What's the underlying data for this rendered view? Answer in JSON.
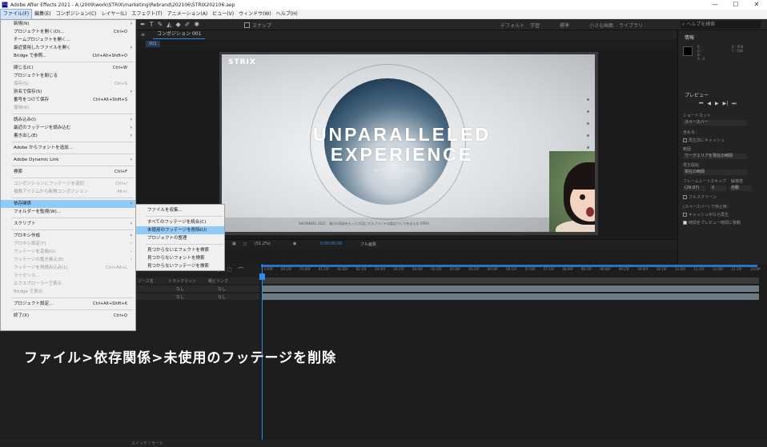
{
  "window": {
    "title": "Adobe After Effects 2021 - A:\\2009\\work\\STRIX\\marketing\\Rebrand\\202106\\STRIX202106.aep",
    "icon_text": "Ae",
    "controls": [
      "—",
      "☐",
      "✕"
    ]
  },
  "menubar": {
    "items": [
      "ファイル(F)",
      "編集(E)",
      "コンポジション(C)",
      "レイヤー(L)",
      "エフェクト(T)",
      "アニメーション(A)",
      "ビュー(V)",
      "ウィンドウ(W)",
      "ヘルプ(H)"
    ],
    "active_index": 0
  },
  "toolbar": {
    "snap_label": "スナップ",
    "workspaces": [
      "デフォルト",
      "学習",
      "標準",
      "小さな画面",
      "ライブラリ"
    ],
    "search_placeholder": "ヘルプを検索"
  },
  "composition": {
    "tab_label": "コンポジション 001",
    "comp_chip": "001",
    "banner": {
      "logo": "STRIX",
      "title_line1": "UNPARALLELED",
      "title_line2": "EXPERIENCE",
      "subtitle": "わくわく、を、えらぼう。",
      "footer": "SHOWREEL 2021　毎日の家族をもっと大切にするブランドの製品づくりを支える STRIX"
    },
    "viewer_controls": {
      "zoom": "(51.2%)",
      "timecode": "0:00:00:00",
      "resolution": "フル画質"
    }
  },
  "right_panel": {
    "info_title": "情報",
    "info_values_left": [
      "R :",
      "G :",
      "B :",
      "A : 0"
    ],
    "info_values_right": [
      "X : 958",
      "Y : 548"
    ],
    "preview_title": "プレビュー",
    "preview_buttons": [
      "⏮",
      "◀",
      "▶",
      "▶|",
      "⏭"
    ],
    "shortcut_label": "ショートカット",
    "shortcut_value": "スペースバー",
    "include_label": "含める：",
    "cache_label": "再生前にキャッシュ",
    "range_label": "範囲",
    "range_value": "ワークエリアを現在の時間",
    "play_from_label": "再生開始",
    "play_from_value": "現在の時間",
    "frame_rate_label": "フレームレート",
    "skip_label": "スキップ",
    "resolution_label": "解像度",
    "frame_rate_value": "(29.97)",
    "skip_value": "0",
    "resolution_value": "自動",
    "fullscreen_label": "フルスクリーン",
    "stop_label": "(スペースバー) で停止時：",
    "option1": "キャッシュ中なら再生",
    "option2": "時間をプレビュー時間に移動"
  },
  "timeline": {
    "columns": [
      "ソース名",
      "トラックマット",
      "親とリンク"
    ],
    "rows": [
      {
        "label": "なし",
        "parent": "なし"
      },
      {
        "label": "なし",
        "parent": "なし"
      }
    ],
    "ruler_ticks": [
      "0:00f",
      "00:15f",
      "01:00f",
      "01:15f",
      "02:00f",
      "02:15f",
      "03:00f",
      "03:15f",
      "04:00f",
      "04:15f",
      "05:00f",
      "05:15f",
      "06:00f",
      "06:15f",
      "07:00f",
      "07:15f",
      "08:00f",
      "08:15f",
      "09:00f",
      "09:15f",
      "10:00f",
      "10:15f",
      "11:00f",
      "11:15f",
      "12:00f",
      "12:15f",
      "13:00f"
    ],
    "status_toggle": "スイッチ / モード"
  },
  "file_menu": {
    "groups": [
      [
        {
          "label": "新規(N)",
          "arrow": true
        },
        {
          "label": "プロジェクトを開く(O)...",
          "shortcut": "Ctrl+O"
        },
        {
          "label": "チームプロジェクトを開く..."
        },
        {
          "label": "最近使用したファイルを開く",
          "arrow": true
        },
        {
          "label": "Bridge で参照...",
          "shortcut": "Ctrl+Alt+Shift+O"
        }
      ],
      [
        {
          "label": "閉じる(C)",
          "shortcut": "Ctrl+W"
        },
        {
          "label": "プロジェクトを閉じる"
        },
        {
          "label": "保存(S)",
          "shortcut": "Ctrl+S",
          "disabled": true
        },
        {
          "label": "別名で保存(S)",
          "arrow": true
        },
        {
          "label": "番号をつけて保存",
          "shortcut": "Ctrl+Alt+Shift+S"
        },
        {
          "label": "復帰(R)",
          "disabled": true
        }
      ],
      [
        {
          "label": "読み込み(I)",
          "arrow": true
        },
        {
          "label": "最近のフッテージを読み込む",
          "arrow": true
        },
        {
          "label": "書き出し(E)",
          "arrow": true
        }
      ],
      [
        {
          "label": "Adobe からフォントを追加..."
        }
      ],
      [
        {
          "label": "Adobe Dynamic Link",
          "arrow": true
        }
      ],
      [
        {
          "label": "検索",
          "shortcut": "Ctrl+F"
        }
      ],
      [
        {
          "label": "コンポジションにフッテージを追加",
          "shortcut": "Ctrl+/",
          "disabled": true
        },
        {
          "label": "複数アイテムから新規コンポジション",
          "shortcut": "Alt+\\",
          "disabled": true
        }
      ],
      [
        {
          "label": "依存関係",
          "arrow": true,
          "highlight": true
        },
        {
          "label": "フォルダーを監視(W)..."
        }
      ],
      [
        {
          "label": "スクリプト",
          "arrow": true
        }
      ],
      [
        {
          "label": "プロキシ作成",
          "arrow": true
        },
        {
          "label": "プロキシ設定(Y)",
          "arrow": true,
          "disabled": true
        },
        {
          "label": "フッテージを変換(G)",
          "arrow": true,
          "disabled": true
        },
        {
          "label": "フッテージの置き換え(E)",
          "arrow": true,
          "disabled": true
        },
        {
          "label": "フッテージを再読み込み(L)",
          "shortcut": "Ctrl+Alt+L",
          "disabled": true
        },
        {
          "label": "ライセンス...",
          "disabled": true
        },
        {
          "label": "エクスプローラーで表示",
          "disabled": true
        },
        {
          "label": "Bridge で表示",
          "disabled": true
        }
      ],
      [
        {
          "label": "プロジェクト設定...",
          "shortcut": "Ctrl+Alt+Shift+K"
        }
      ],
      [
        {
          "label": "終了(X)",
          "shortcut": "Ctrl+Q"
        }
      ]
    ]
  },
  "submenu": {
    "groups": [
      [
        {
          "label": "ファイルを収集..."
        }
      ],
      [
        {
          "label": "すべてのフッテージを統合(C)"
        },
        {
          "label": "未使用のフッテージを削除(U)",
          "highlight": true
        },
        {
          "label": "プロジェクトの整理"
        }
      ],
      [
        {
          "label": "見つからないエフェクトを検索"
        },
        {
          "label": "見つからないフォントを検索"
        },
        {
          "label": "見つからないフッテージを検索"
        }
      ]
    ]
  },
  "caption": "ファイル>依存関係>未使用のフッテージを削除",
  "colors": {
    "accent": "#2d8ceb",
    "menu_highlight": "#91c9f7",
    "panel_bg": "#1d1d1d"
  }
}
